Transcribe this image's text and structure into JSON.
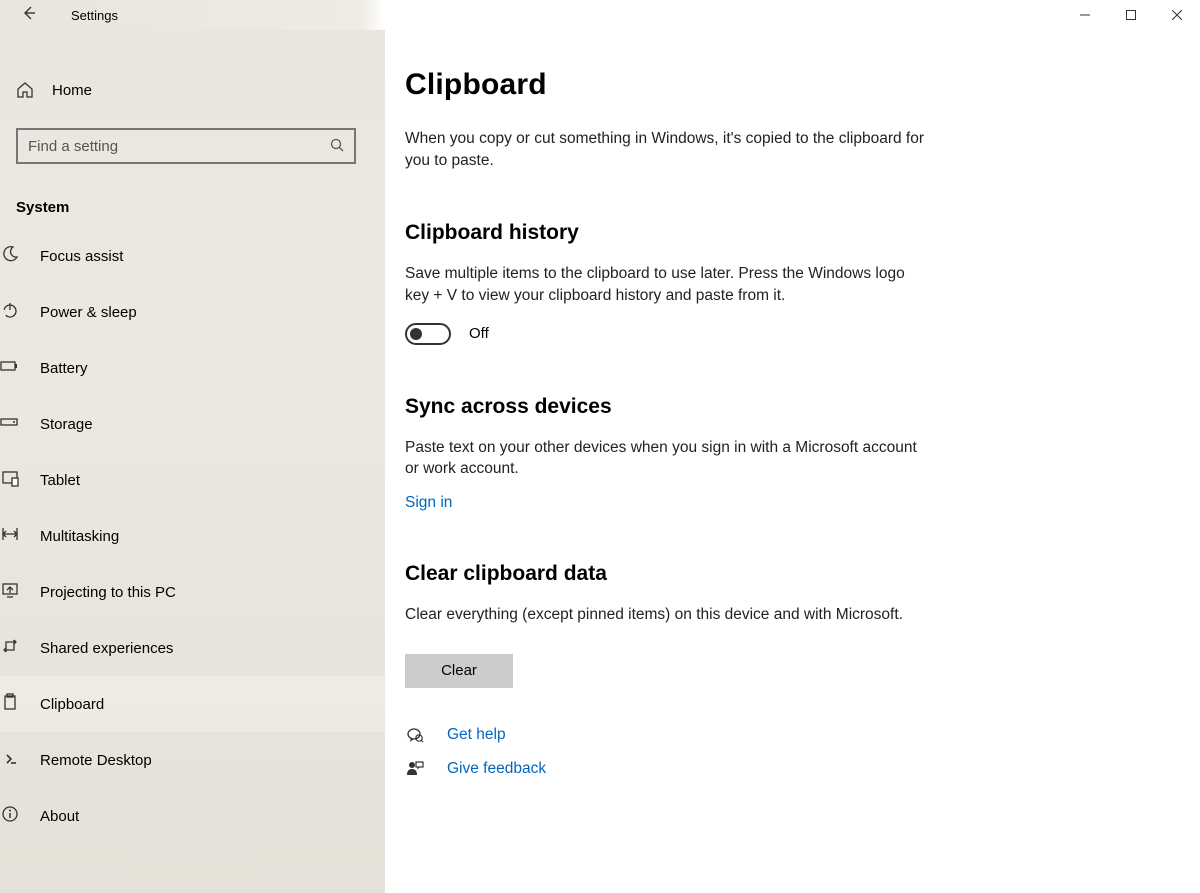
{
  "titlebar": {
    "title": "Settings"
  },
  "sidebar": {
    "home_label": "Home",
    "search_placeholder": "Find a setting",
    "category": "System",
    "items": [
      {
        "label": "Focus assist",
        "icon": "moon"
      },
      {
        "label": "Power & sleep",
        "icon": "power"
      },
      {
        "label": "Battery",
        "icon": "battery"
      },
      {
        "label": "Storage",
        "icon": "storage"
      },
      {
        "label": "Tablet",
        "icon": "tablet"
      },
      {
        "label": "Multitasking",
        "icon": "multitask"
      },
      {
        "label": "Projecting to this PC",
        "icon": "project"
      },
      {
        "label": "Shared experiences",
        "icon": "shared"
      },
      {
        "label": "Clipboard",
        "icon": "clipboard"
      },
      {
        "label": "Remote Desktop",
        "icon": "remote"
      },
      {
        "label": "About",
        "icon": "about"
      }
    ],
    "selected_index": 8
  },
  "page": {
    "title": "Clipboard",
    "intro": "When you copy or cut something in Windows, it's copied to the clipboard for you to paste.",
    "history_section": {
      "title": "Clipboard history",
      "desc": "Save multiple items to the clipboard to use later. Press the Windows logo key + V to view your clipboard history and paste from it.",
      "toggle_state": "Off"
    },
    "sync_section": {
      "title": "Sync across devices",
      "desc": "Paste text on your other devices when you sign in with a Microsoft account or work account.",
      "link_label": "Sign in"
    },
    "clear_section": {
      "title": "Clear clipboard data",
      "desc": "Clear everything (except pinned items) on this device and with Microsoft.",
      "button_label": "Clear"
    },
    "help": {
      "get_help": "Get help",
      "give_feedback": "Give feedback"
    }
  }
}
